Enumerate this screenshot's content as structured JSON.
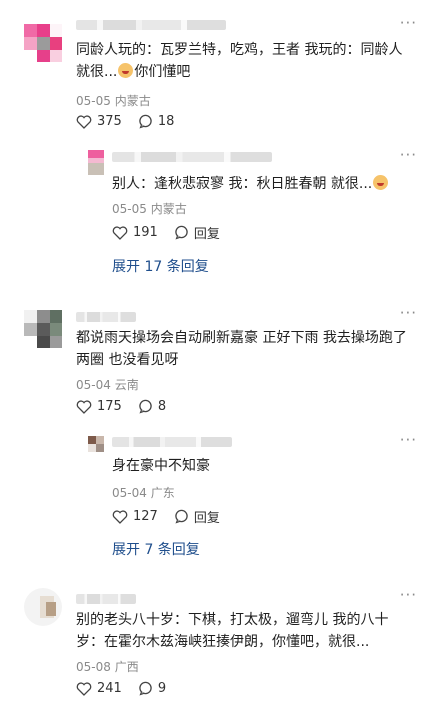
{
  "comments": [
    {
      "text_line1": "同龄人玩的：瓦罗兰特，吃鸡，王者 我玩的：同龄人",
      "text_line2_pre": "就很...",
      "text_line2_post": "你们懂吧",
      "date": "05-05",
      "location": "内蒙古",
      "likes": "375",
      "comments": "18",
      "reply": {
        "text_pre": "别人：逢秋悲寂寥 我：秋日胜春朝 就很...",
        "date": "05-05",
        "location": "内蒙古",
        "likes": "191",
        "reply_label": "回复"
      },
      "expand_label": "展开 17 条回复"
    },
    {
      "text_line1": "都说雨天操场会自动刷新嘉豪 正好下雨 我去操场跑了",
      "text_line2": "两圈 也没看见呀",
      "date": "05-04",
      "location": "云南",
      "likes": "175",
      "comments": "8",
      "reply": {
        "text_pre": "身在豪中不知豪",
        "date": "05-04",
        "location": "广东",
        "likes": "127",
        "reply_label": "回复"
      },
      "expand_label": "展开 7 条回复"
    },
    {
      "text_line1": "别的老头八十岁：下棋，打太极，遛弯儿 我的八十",
      "text_line2": "岁：在霍尔木兹海峡狂揍伊朗，你懂吧，就很...",
      "date": "05-08",
      "location": "广西",
      "likes": "241",
      "comments": "9"
    }
  ],
  "more_label": "···",
  "icons": {
    "like": "heart-outline-icon",
    "comment": "speech-bubble-icon",
    "more": "more-dots-icon",
    "emoji": "crying-laughing-emoji-icon"
  },
  "colors": {
    "link": "#1f4e8c",
    "meta": "#8a8a8a",
    "text": "#1f1f1f"
  }
}
